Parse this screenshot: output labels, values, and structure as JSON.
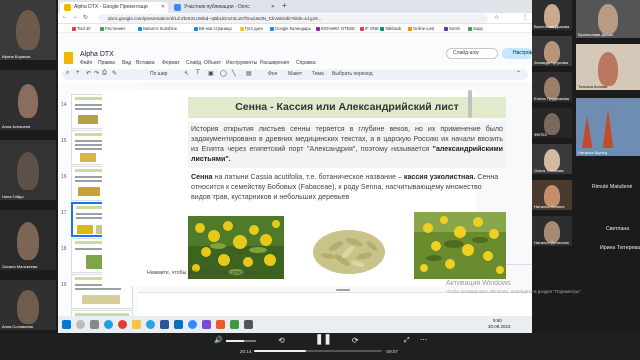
{
  "browser": {
    "tabs": [
      {
        "label": "Alpha DTX - Google Презентаци",
        "icon_color": "#f4b400",
        "active": true
      },
      {
        "label": "Участник публикации - Dоnc",
        "icon_color": "#4285f4",
        "active": false
      }
    ],
    "url": "docs.google.com/presentation/d/1d-Zbr531UWbd--qBbLiEmz3Lu07fSudJw3N_CkVak/edit?slide=id.g19...",
    "bookmarks": [
      {
        "label": "Tool 40",
        "color": "#e53935"
      },
      {
        "label": "Растениеv",
        "color": "#43a047"
      },
      {
        "label": "Nature's Sunshine",
        "color": "#1e88e5"
      },
      {
        "label": "ВК-нов страница",
        "color": "#1e88e5"
      },
      {
        "label": "Гугл диск",
        "color": "#fbc02d"
      },
      {
        "label": "Google Календарь",
        "color": "#1e88e5"
      },
      {
        "label": "ЮОНИКА ОТЕЕЕ",
        "color": "#8e24aa"
      },
      {
        "label": "IF ONE",
        "color": "#e53935"
      },
      {
        "label": "Talkbook",
        "color": "#00897b"
      },
      {
        "label": "Online-Lesl",
        "color": "#fb8c00"
      },
      {
        "label": "Sentri",
        "color": "#5e35b1"
      },
      {
        "label": "Supp",
        "color": "#43a047"
      }
    ]
  },
  "doc": {
    "title": "Alpha DTX",
    "menu": [
      "Файл",
      "Правка",
      "Вид",
      "Вставка",
      "Формат",
      "Слайд",
      "Объект",
      "Инструменты",
      "Расширения",
      "Справка"
    ],
    "slideshow_label": "Слайд-шоу",
    "share_label": "Настройки",
    "toolbar": {
      "zoom_label": "По шир",
      "bg_label": "Фон",
      "layout_label": "Макет",
      "theme_label": "Тема",
      "transition_label": "Выбрать переход"
    },
    "thumb_numbers": [
      "14",
      "15",
      "16",
      "17",
      "18",
      "19",
      "20"
    ],
    "notes_placeholder": "Нажмите, чтобы добавить заметки докладчика"
  },
  "slide": {
    "title": "Сенна - Кассия или Александрийский лист",
    "para1": "История открытия листьев сенны теряется в глубине веков, но их применение было задокументировано в древних медицинских текстах, а в царскую Россию их начали ввозить из Египта через египетский порт \"Александрия\", поэтому называется",
    "para1_bold": "\"александрийскими листьями\".",
    "para2_bold1": "Сенна",
    "para2_a": " на латыни Cassia acutifolia, т.е. ботаническое название – ",
    "para2_bold2": "кассия узколистная.",
    "para2_b": " Сенна относится к семейству Бобовых (Fabaceae), к роду Senna, насчитывающему множество видов трав, кустарников и небольших деревьев"
  },
  "windows": {
    "watermark_title": "Активация Windows",
    "watermark_sub": "Чтобы активировать Windows, перейдите в раздел \"Параметры\".",
    "clock_time": "9:50",
    "clock_date": "30.09.2023"
  },
  "player": {
    "elapsed": "20:14",
    "remaining": "-29:07",
    "progress_fraction": 0.41,
    "volume_fraction": 0.6
  },
  "participants": {
    "left": [
      {
        "name": "Ирина Бориков"
      },
      {
        "name": "Анна Алексеев"
      },
      {
        "name": "Нина Гойдо"
      },
      {
        "name": "Оксана Малькеева"
      },
      {
        "name": "Анна Соловьева"
      }
    ],
    "right_small": [
      {
        "name": "Валентина Дыкова"
      },
      {
        "name": "Зинаида Чугунова"
      },
      {
        "name": "Елена Прудникова"
      },
      {
        "name": "ФКП53"
      },
      {
        "name": "Ольга Тихонова"
      },
      {
        "name": "Наталья Липина"
      },
      {
        "name": "Наталья Денисова"
      }
    ],
    "right_big": [
      {
        "name": "Бронислава Дюкин"
      },
      {
        "name": "Татьяна Колова"
      },
      {
        "name": "Наталья Шульц"
      },
      {
        "name": "Rimutė Matulienė"
      },
      {
        "name": "Светлана"
      },
      {
        "name": "Ирина Тютерева"
      }
    ]
  }
}
